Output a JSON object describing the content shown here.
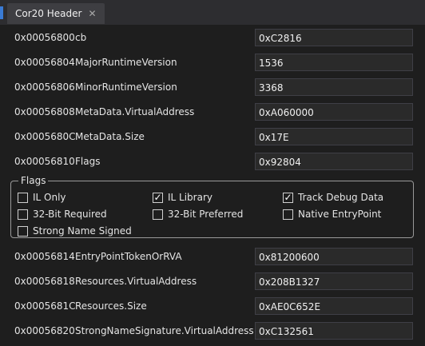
{
  "tab": {
    "title": "Cor20 Header",
    "close": "✕"
  },
  "rows_top": [
    {
      "address": "0x00056800",
      "name": "cb",
      "value": "0xC2816"
    },
    {
      "address": "0x00056804",
      "name": "MajorRuntimeVersion",
      "value": "1536"
    },
    {
      "address": "0x00056806",
      "name": "MinorRuntimeVersion",
      "value": "3368"
    },
    {
      "address": "0x00056808",
      "name": "MetaData.VirtualAddress",
      "value": "0xA060000"
    },
    {
      "address": "0x0005680C",
      "name": "MetaData.Size",
      "value": "0x17E"
    },
    {
      "address": "0x00056810",
      "name": "Flags",
      "value": "0x92804"
    }
  ],
  "flags": {
    "title": "Flags",
    "items": [
      {
        "label": "IL Only",
        "checked": false
      },
      {
        "label": "IL Library",
        "checked": true
      },
      {
        "label": "Track Debug Data",
        "checked": true
      },
      {
        "label": "32-Bit Required",
        "checked": false
      },
      {
        "label": "32-Bit Preferred",
        "checked": false
      },
      {
        "label": "Native EntryPoint",
        "checked": false
      },
      {
        "label": "Strong Name Signed",
        "checked": false
      }
    ]
  },
  "rows_bottom": [
    {
      "address": "0x00056814",
      "name": "EntryPointTokenOrRVA",
      "value": "0x81200600"
    },
    {
      "address": "0x00056818",
      "name": "Resources.VirtualAddress",
      "value": "0x208B1327"
    },
    {
      "address": "0x0005681C",
      "name": "Resources.Size",
      "value": "0xAE0C652E"
    },
    {
      "address": "0x00056820",
      "name": "StrongNameSignature.VirtualAddress",
      "value": "0xC132561"
    }
  ],
  "colors": {
    "background": "#1e1e1e",
    "tabstrip": "#2d2d30",
    "accent": "#3a7bd5"
  },
  "icons": {
    "tab_close": "close-icon",
    "check": "check-icon"
  }
}
